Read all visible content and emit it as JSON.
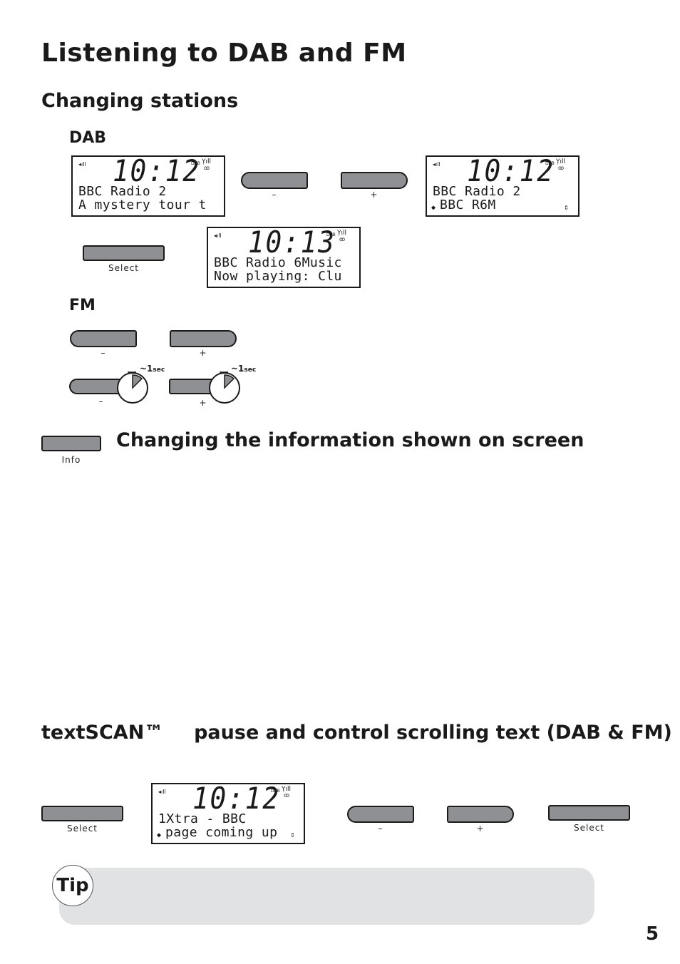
{
  "page": {
    "title": "Listening to DAB and FM",
    "page_number": "5"
  },
  "changing_stations": {
    "heading": "Changing stations",
    "dab": {
      "label": "DAB",
      "display_before": {
        "time": "10:12",
        "band": "DAB",
        "line1": "BBC Radio 2",
        "line2": "A mystery tour t"
      },
      "minus_label": "–",
      "plus_label": "+",
      "display_browse": {
        "time": "10:12",
        "band": "DAB",
        "line1": "BBC Radio 2",
        "line2": "BBC R6M",
        "arrow_left": "◆",
        "arrow_right": "⇕"
      },
      "select_label": "Select",
      "display_after": {
        "time": "10:13",
        "band": "DAB",
        "line1": "BBC Radio 6Music",
        "line2": "Now playing: Clu"
      }
    },
    "fm": {
      "label": "FM",
      "minus_label": "–",
      "plus_label": "+",
      "hold_minus_label": "–",
      "hold_plus_label": "+",
      "hold_duration": "~1",
      "hold_unit": "sec"
    }
  },
  "info_section": {
    "button_label": "Info",
    "heading": "Changing the information shown on screen"
  },
  "textscan": {
    "heading_brand": "textSCAN™",
    "heading_text": "pause and control scrolling text (DAB & FM)",
    "select_label_1": "Select",
    "display": {
      "time": "10:12",
      "band": "DAB",
      "line1": "1Xtra - BBC",
      "line2": "page coming up",
      "arrow_left": "◆",
      "arrow_right": "⇕"
    },
    "minus_label": "–",
    "plus_label": "+",
    "select_label_2": "Select"
  },
  "tip": {
    "label": "Tip"
  },
  "icons": {
    "volume": "◂ıll",
    "signal": "Ỵıll",
    "stereo": "ꝏ",
    "timer": "stopwatch"
  }
}
